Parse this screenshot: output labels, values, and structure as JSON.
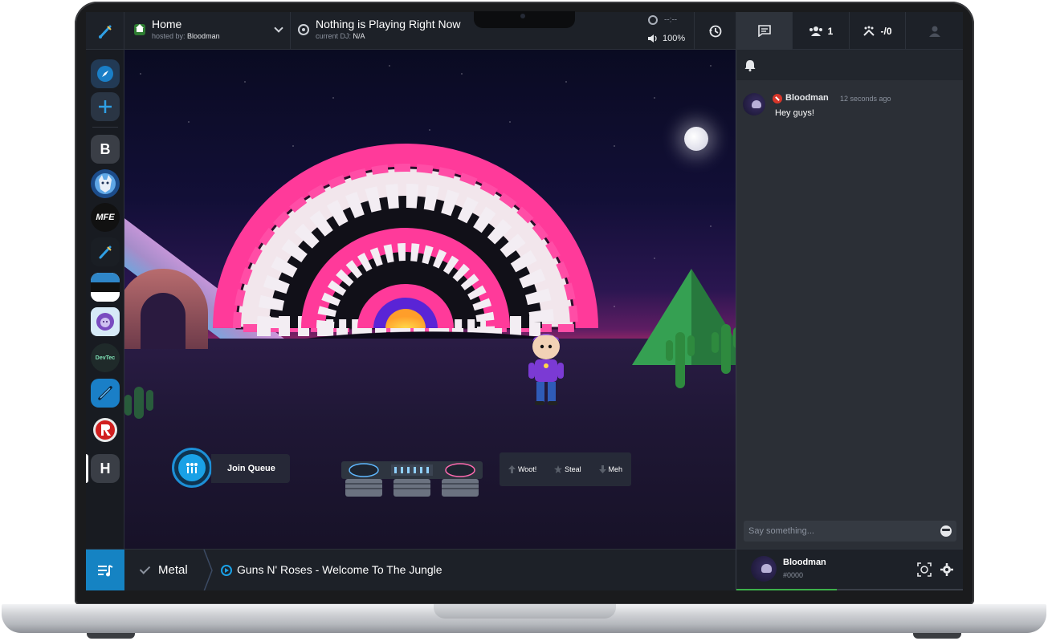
{
  "room": {
    "title": "Home",
    "hosted_by_prefix": "hosted by:",
    "host": "Bloodman"
  },
  "now_playing": {
    "title": "Nothing is Playing Right Now",
    "dj_prefix": "current DJ:",
    "dj": "N/A",
    "time": "--:--",
    "volume": "100%"
  },
  "tabs": {
    "users_count": "1",
    "grab_count": "-/0"
  },
  "rail": {
    "items": [
      {
        "name": "rail-item-explore",
        "icon": "compass-icon",
        "color": "#1a6fb0"
      },
      {
        "name": "rail-item-create",
        "icon": "plus-icon",
        "color": "#2a3f55"
      },
      {
        "name": "rail-item-b",
        "letter": "B",
        "color": "#3a3e46"
      },
      {
        "name": "rail-item-wolf",
        "icon": "wolf-icon",
        "color": "#1c4c8a"
      },
      {
        "name": "rail-item-mfe",
        "letter": "MFE",
        "color": "#111111"
      },
      {
        "name": "rail-item-guitar",
        "icon": "guitar-icon",
        "color": "#1a1e24"
      },
      {
        "name": "rail-item-stripe",
        "icon": "stripe-icon",
        "color": "#2288c8"
      },
      {
        "name": "rail-item-lion",
        "icon": "lion-icon",
        "color": "#d7eaf7"
      },
      {
        "name": "rail-item-devtec",
        "letter": "DevTec",
        "color": "#1f2a2a"
      },
      {
        "name": "rail-item-pen",
        "icon": "pen-icon",
        "color": "#1a7fc7"
      },
      {
        "name": "rail-item-r",
        "icon": "r-logo-icon",
        "color": "#e0e0e0"
      },
      {
        "name": "rail-item-h",
        "letter": "H",
        "color": "#3a3e46"
      }
    ]
  },
  "stage": {
    "join_queue_label": "Join Queue",
    "votes": {
      "woot": "Woot!",
      "steal": "Steal",
      "meh": "Meh"
    }
  },
  "bottom": {
    "playlist_name": "Metal",
    "song": "Guns N' Roses - Welcome To The Jungle"
  },
  "chat": {
    "messages": [
      {
        "user": "Bloodman",
        "time": "12 seconds ago",
        "text": "Hey guys!"
      }
    ],
    "input_placeholder": "Say something..."
  },
  "user": {
    "name": "Bloodman",
    "tag": "#0000",
    "progress": 0.44
  },
  "colors": {
    "accent": "#1583c3",
    "brand_pink": "#ff3a9a",
    "panel": "#2b2f36",
    "topbar": "#1d2128"
  }
}
